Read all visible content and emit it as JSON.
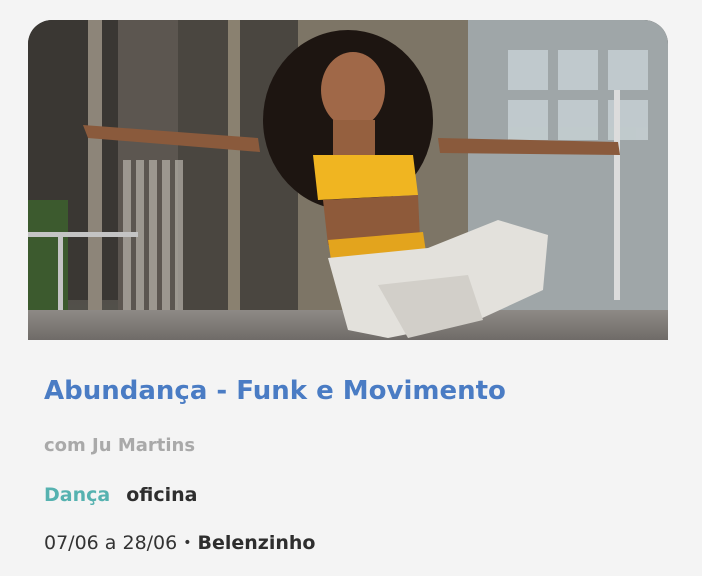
{
  "event": {
    "title": "Abundança - Funk e Movimento",
    "facilitator": "com Ju Martins",
    "category": "Dança",
    "type": "oficina",
    "dates": "07/06 a 28/06",
    "separator": "•",
    "venue": "Belenzinho"
  },
  "colors": {
    "title": "#4a7cc4",
    "facilitator": "#a9a9a9",
    "category": "#56b2b0",
    "text": "#2e2e2e",
    "background": "#f4f4f4"
  }
}
